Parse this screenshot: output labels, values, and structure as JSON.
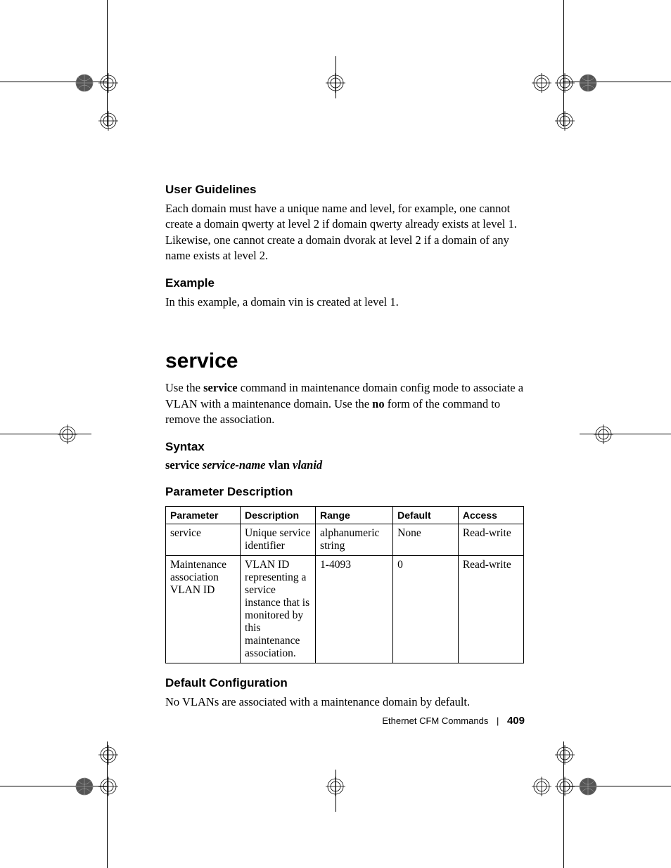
{
  "sections": {
    "user_guidelines": {
      "heading": "User Guidelines",
      "body": "Each domain must have a unique name and level, for example, one cannot create a domain qwerty at level 2 if domain qwerty already exists at level 1. Likewise, one cannot create a domain dvorak at level 2 if a domain of any name exists at level 2."
    },
    "example": {
      "heading": "Example",
      "body": "In this example, a domain vin is created at level 1."
    },
    "service": {
      "title": "service",
      "intro_pre": "Use the ",
      "intro_cmd": "service",
      "intro_mid": " command in maintenance domain config mode to associate a VLAN with a maintenance domain. Use the ",
      "intro_no": "no",
      "intro_post": " form of the command to remove the association."
    },
    "syntax": {
      "heading": "Syntax",
      "kw1": "service ",
      "arg1": "service-name",
      "kw2": " vlan ",
      "arg2": "vlanid"
    },
    "param_desc": {
      "heading": "Parameter Description",
      "headers": [
        "Parameter",
        "Description",
        "Range",
        "Default",
        "Access"
      ],
      "rows": [
        {
          "parameter": "service",
          "description": "Unique service identifier",
          "range": "alphanumeric string",
          "default": "None",
          "access": "Read-write"
        },
        {
          "parameter": "Maintenance association VLAN ID",
          "description": "VLAN ID representing a service instance that is monitored by this maintenance association.",
          "range": "1-4093",
          "default": "0",
          "access": "Read-write"
        }
      ]
    },
    "default_config": {
      "heading": "Default Configuration",
      "body": "No VLANs are associated with a maintenance domain by default."
    }
  },
  "footer": {
    "chapter": "Ethernet CFM Commands",
    "page": "409"
  }
}
